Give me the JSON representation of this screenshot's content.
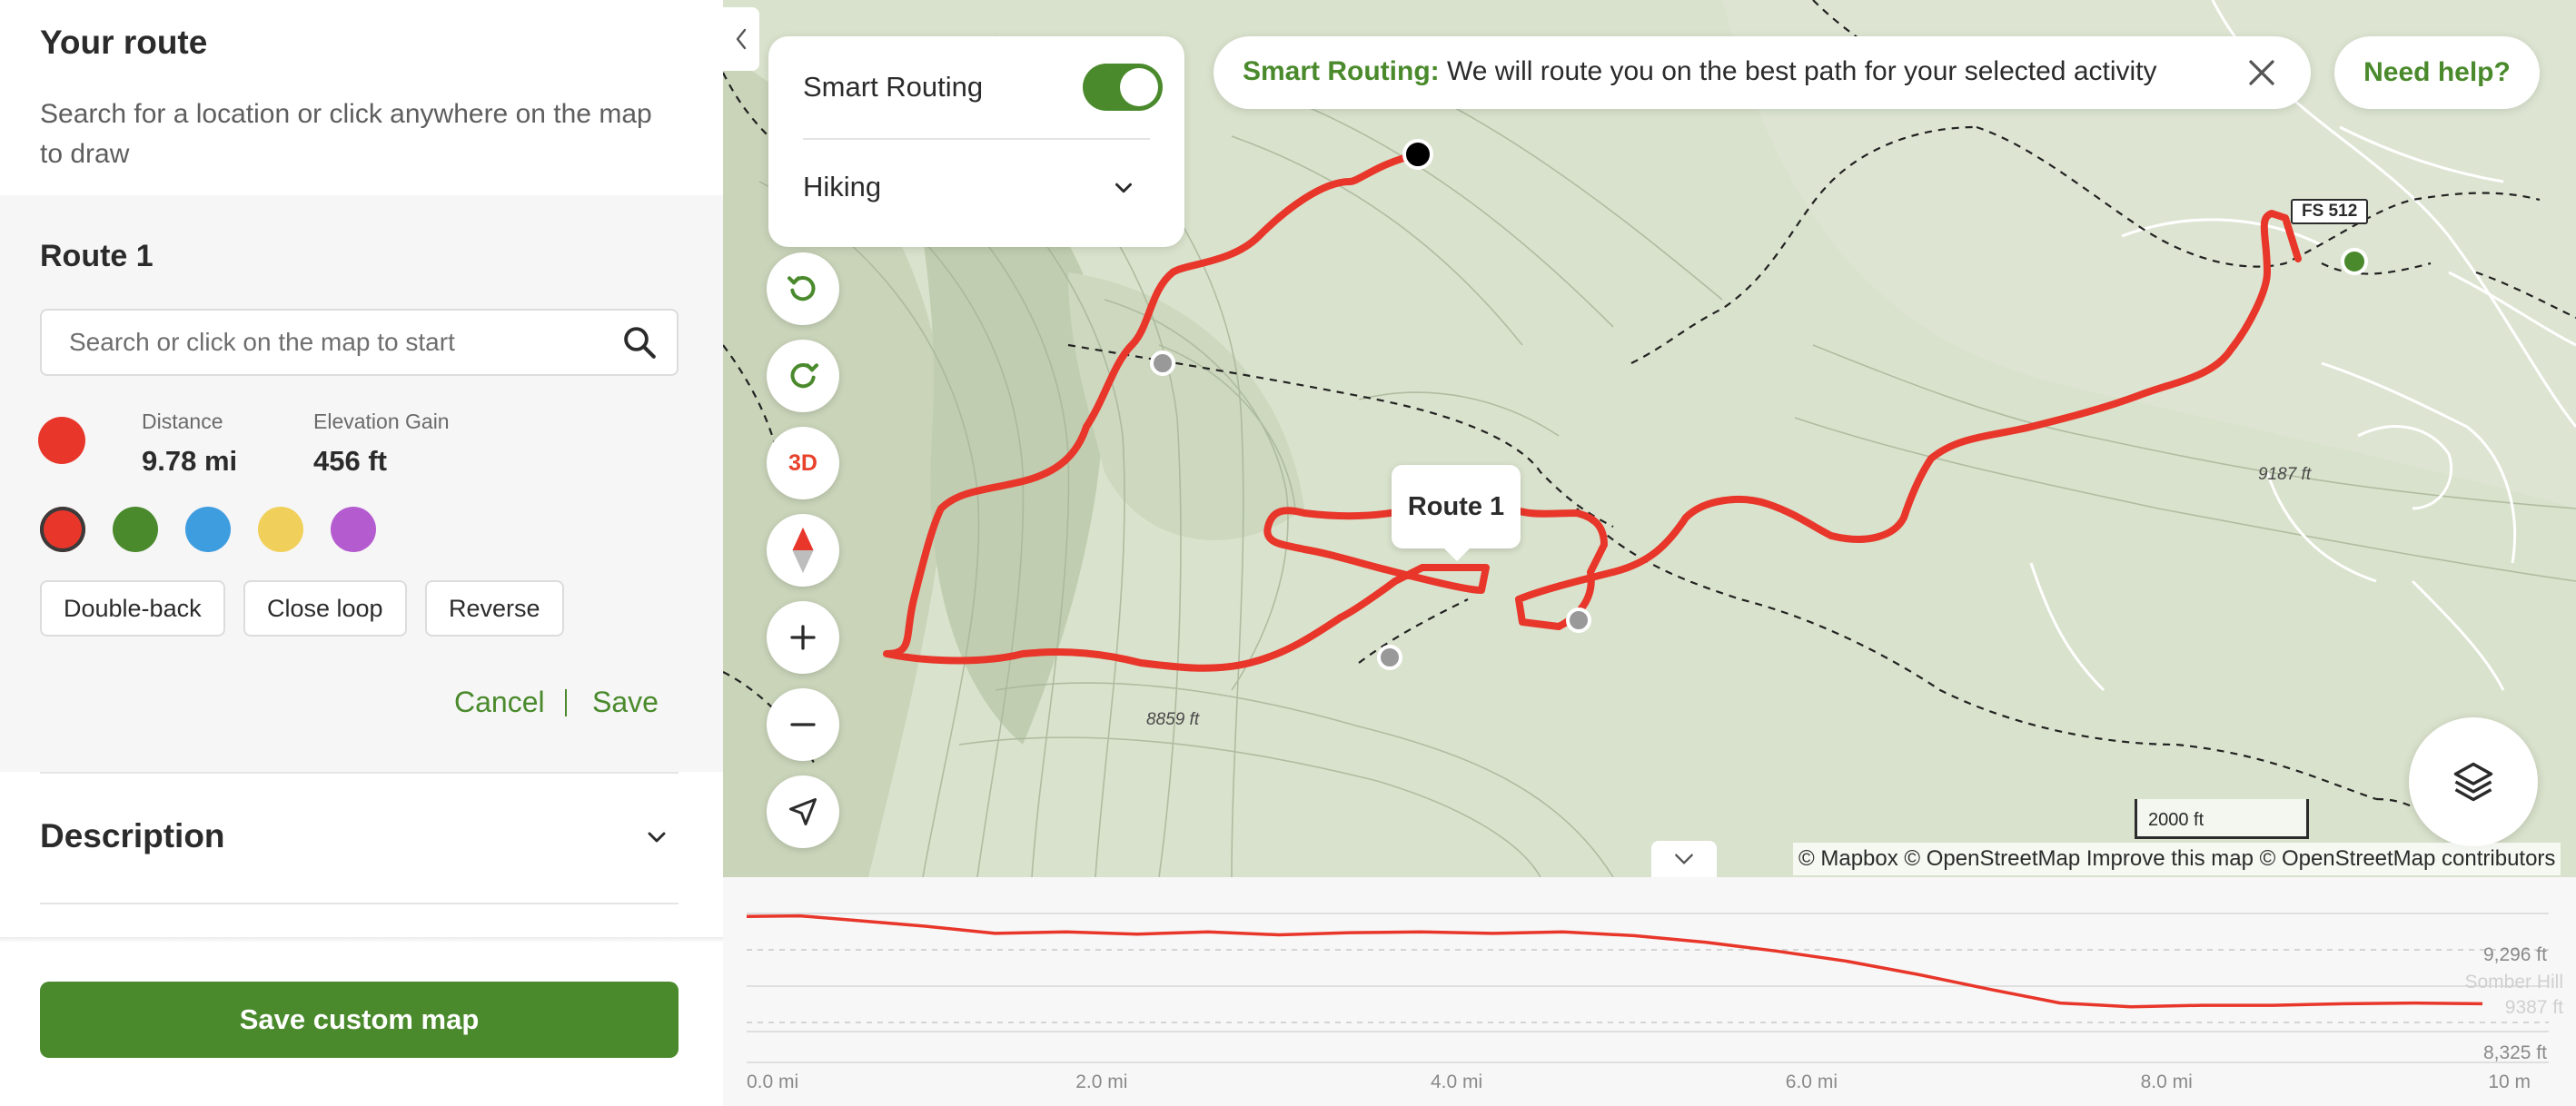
{
  "sidebar": {
    "title": "Your route",
    "subtitle": "Search for a location or click anywhere on the map to draw",
    "route": {
      "name": "Route 1",
      "search_placeholder": "Search or click on the map to start",
      "color": "#e8362a",
      "stats": [
        {
          "label": "Distance",
          "value": "9.78 mi"
        },
        {
          "label": "Elevation Gain",
          "value": "456 ft"
        }
      ],
      "color_options": [
        {
          "name": "red",
          "hex": "#e8362a",
          "selected": true
        },
        {
          "name": "green",
          "hex": "#4a8a2c",
          "selected": false
        },
        {
          "name": "blue",
          "hex": "#3e9ddf",
          "selected": false
        },
        {
          "name": "yellow",
          "hex": "#f0d05a",
          "selected": false
        },
        {
          "name": "purple",
          "hex": "#b55bd0",
          "selected": false
        }
      ],
      "actions": [
        "Double-back",
        "Close loop",
        "Reverse"
      ],
      "cancel_label": "Cancel",
      "save_label": "Save"
    },
    "description_label": "Description",
    "save_map_label": "Save custom map"
  },
  "map_controls": {
    "smart_routing_label": "Smart Routing",
    "smart_routing_on": true,
    "activity": "Hiking",
    "three_d_label": "3D",
    "icons": [
      "undo-icon",
      "redo-icon",
      "compass-icon",
      "zoom-in-icon",
      "zoom-out-icon",
      "locate-icon",
      "layers-icon"
    ]
  },
  "banner": {
    "strong": "Smart Routing:",
    "text": " We will route you on the best path for your selected activity"
  },
  "help_label": "Need help?",
  "map": {
    "route_label": "Route 1",
    "road_label": "FS 512",
    "elevation_labels": [
      "9187 ft",
      "8859 ft"
    ],
    "scale_label": "2000 ft",
    "attribution": "© Mapbox © OpenStreetMap Improve this map © OpenStreetMap contributors"
  },
  "elevation_chart": {
    "x_ticks": [
      "0.0 mi",
      "2.0 mi",
      "4.0 mi",
      "6.0 mi",
      "8.0 mi",
      "10 m"
    ],
    "y_labels": [
      "9,296 ft",
      "8,325 ft"
    ],
    "faded_labels": [
      "Somber Hill",
      "9387 ft"
    ]
  },
  "chart_data": {
    "type": "line",
    "x": [
      0,
      0.3,
      0.6,
      1.0,
      1.4,
      1.8,
      2.2,
      2.6,
      3.0,
      3.4,
      3.8,
      4.2,
      4.6,
      5.0,
      5.4,
      5.8,
      6.2,
      6.6,
      7.0,
      7.4,
      7.8,
      8.2,
      8.6,
      9.0,
      9.4,
      9.78
    ],
    "series": [
      {
        "values": [
          9296,
          9300,
          9270,
          9230,
          9180,
          9190,
          9175,
          9190,
          9170,
          9185,
          9190,
          9180,
          9190,
          9165,
          9120,
          9060,
          8990,
          8900,
          8800,
          8705,
          8680,
          8690,
          8690,
          8700,
          8705,
          8700
        ]
      }
    ],
    "xlim": [
      0,
      10
    ],
    "ylim": [
      8325,
      9296
    ],
    "y_labels": [
      "9,296 ft",
      "8,325 ft"
    ],
    "color": "#e8362a",
    "grid": true
  }
}
